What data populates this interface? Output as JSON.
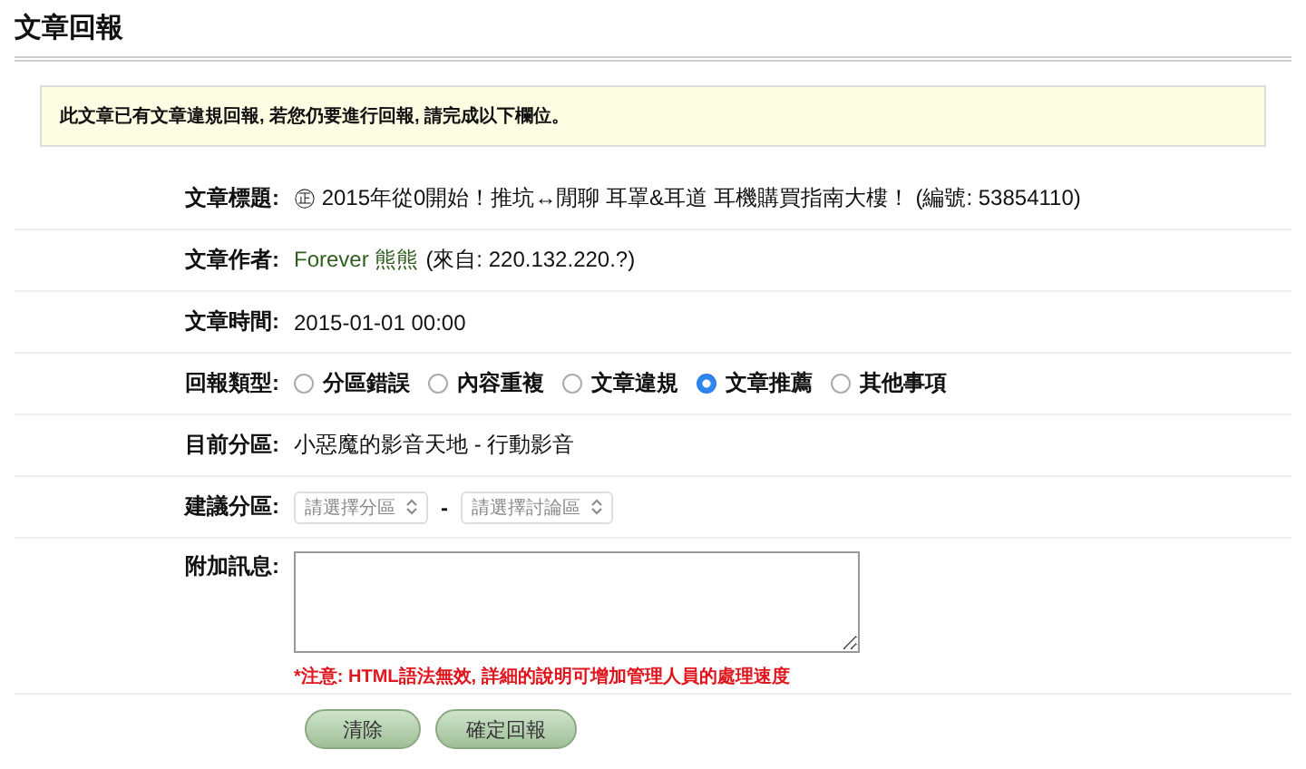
{
  "page_title": "文章回報",
  "notice": "此文章已有文章違規回報, 若您仍要進行回報, 請完成以下欄位。",
  "fields": [
    {
      "kind": "text",
      "label": "文章標題:",
      "value": "㊣ 2015年從0開始！推坑↔閒聊 耳罩&耳道 耳機購買指南大樓！ (編號: 53854110)"
    },
    {
      "kind": "author",
      "label": "文章作者:",
      "name": "Forever 熊熊",
      "value": "(來自: 220.132.220.?)"
    },
    {
      "kind": "text",
      "label": "文章時間:",
      "value": "2015-01-01 00:00"
    },
    {
      "kind": "radios",
      "label": "回報類型:",
      "options": [
        {
          "label": "分區錯誤",
          "selected": false
        },
        {
          "label": "內容重複",
          "selected": false
        },
        {
          "label": "文章違規",
          "selected": false
        },
        {
          "label": "文章推薦",
          "selected": true
        },
        {
          "label": "其他事項",
          "selected": false
        }
      ]
    },
    {
      "kind": "text",
      "label": "目前分區:",
      "value": "小惡魔的影音天地 - 行動影音"
    },
    {
      "kind": "selects",
      "label": "建議分區:",
      "selects": [
        "請選擇分區",
        "請選擇討論區"
      ],
      "separator": "-"
    },
    {
      "kind": "textarea",
      "label": "附加訊息:",
      "note": "*注意: HTML語法無效, 詳細的說明可增加管理人員的處理速度"
    }
  ],
  "buttons": [
    "清除",
    "確定回報"
  ]
}
